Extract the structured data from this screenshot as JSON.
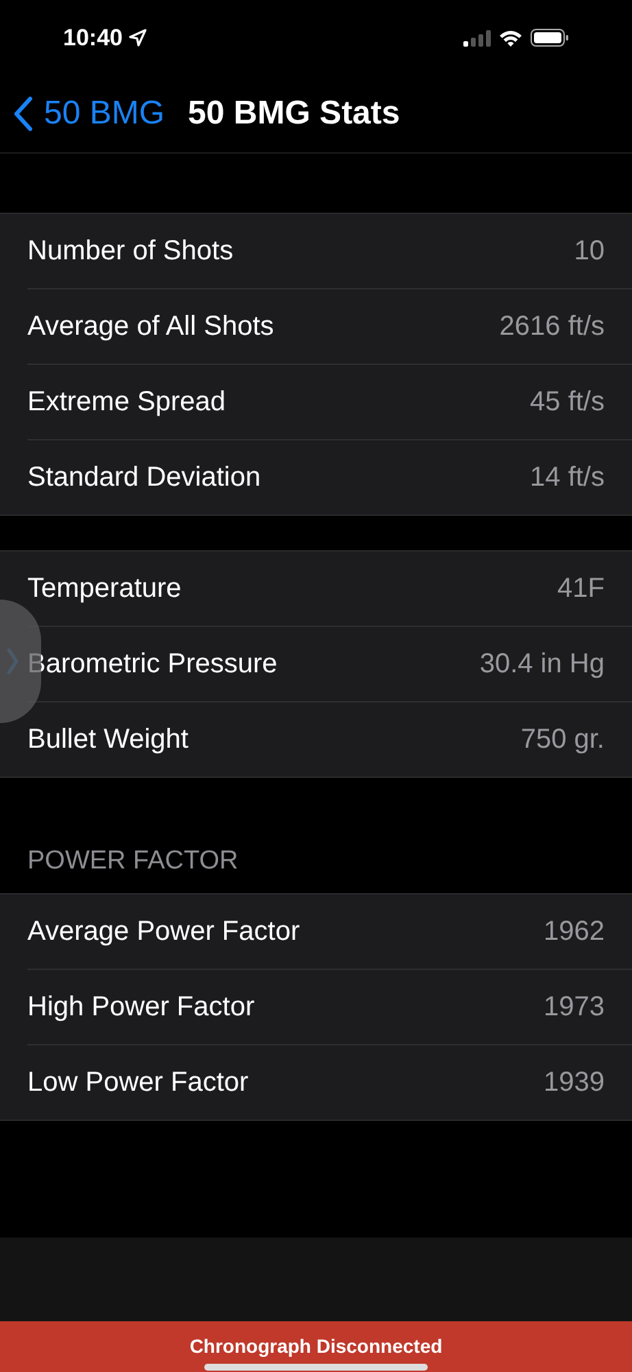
{
  "status_bar": {
    "time": "10:40"
  },
  "nav": {
    "back": "50 BMG",
    "title": "50 BMG Stats"
  },
  "groups": [
    {
      "rows": [
        {
          "label": "Number of Shots",
          "value": "10"
        },
        {
          "label": "Average of All Shots",
          "value": "2616 ft/s"
        },
        {
          "label": "Extreme Spread",
          "value": "45 ft/s"
        },
        {
          "label": "Standard Deviation",
          "value": "14 ft/s"
        }
      ]
    },
    {
      "rows": [
        {
          "label": "Temperature",
          "value": "41F"
        },
        {
          "label": "Barometric Pressure",
          "value": "30.4 in Hg"
        },
        {
          "label": "Bullet Weight",
          "value": "750 gr."
        }
      ]
    },
    {
      "header": "POWER FACTOR",
      "rows": [
        {
          "label": "Average Power Factor",
          "value": "1962"
        },
        {
          "label": "High Power Factor",
          "value": "1973"
        },
        {
          "label": "Low Power Factor",
          "value": "1939"
        }
      ]
    }
  ],
  "banner": {
    "text": "Chronograph Disconnected"
  }
}
